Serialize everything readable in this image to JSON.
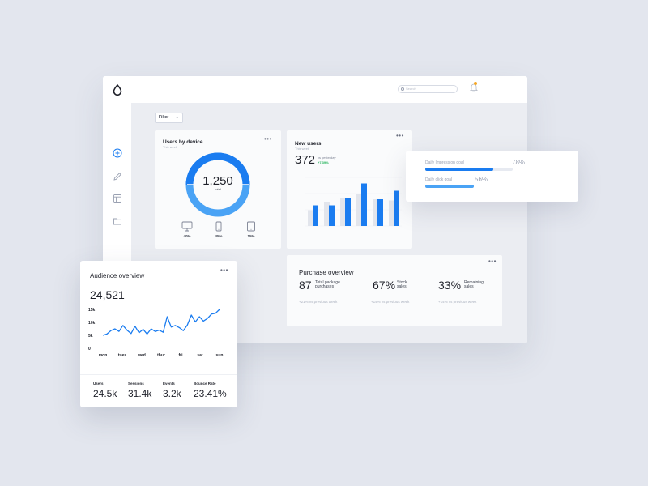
{
  "search": {
    "placeholder": "Search"
  },
  "filter": {
    "label": "Filter",
    "arrow": "→"
  },
  "colors": {
    "accent": "#1a7cf0",
    "accent_light": "#4aa3f5",
    "gray_bar": "#e2e5ec",
    "positive": "#23b35a"
  },
  "sidebar": {
    "icons": [
      "add-circle-icon",
      "pencil-icon",
      "layout-icon",
      "folder-icon"
    ]
  },
  "users_by_device": {
    "title": "Users by device",
    "subtitle": "This week",
    "total": "1,250",
    "total_label": "total",
    "devices": [
      {
        "icon": "desktop-icon",
        "pct": "40%"
      },
      {
        "icon": "mobile-icon",
        "pct": "45%"
      },
      {
        "icon": "tablet-icon",
        "pct": "15%"
      }
    ],
    "donut_share": [
      0.45,
      0.55
    ]
  },
  "new_users": {
    "title": "New users",
    "subtitle": "This week",
    "value": "372",
    "vs_label": "vs yesterday",
    "change": "+7.39%"
  },
  "purchase_overview": {
    "title": "Purchase overview",
    "items": [
      {
        "value": "87",
        "label": "Total package purchases",
        "sub": "+21% vs previous week"
      },
      {
        "value": "67%",
        "label": "Stock sales",
        "sub": "+14% vs previous week"
      },
      {
        "value": "33%",
        "label": "Remaining sales",
        "sub": "+14% vs previous week"
      }
    ]
  },
  "goals": [
    {
      "label": "Daily Impression goal",
      "pct": "78%",
      "value": 0.78,
      "color": "#1a7cf0"
    },
    {
      "label": "Daily click goal",
      "pct": "56%",
      "value": 0.56,
      "color": "#4aa3f5"
    }
  ],
  "audience": {
    "title": "Audience overview",
    "value": "24,521",
    "stats": [
      {
        "label": "Users",
        "value": "24.5k"
      },
      {
        "label": "Sessions",
        "value": "31.4k"
      },
      {
        "label": "Events",
        "value": "3.2k"
      },
      {
        "label": "Bounce Rate",
        "value": "23.41%"
      }
    ]
  },
  "chart_data": [
    {
      "type": "bar",
      "title": "New users",
      "categories": [
        "",
        "",
        "",
        "",
        "",
        ""
      ],
      "yticks": [
        "",
        "",
        "",
        ""
      ],
      "ylim": [
        0,
        4
      ],
      "series": [
        {
          "values": [
            1.3,
            2.0,
            2.3,
            2.6,
            2.2,
            2.1
          ]
        },
        {
          "values": [
            1.7,
            1.7,
            2.3,
            3.5,
            2.2,
            2.9
          ]
        }
      ]
    },
    {
      "type": "line",
      "title": "Audience overview",
      "categories": [
        "mon",
        "tues",
        "wed",
        "thur",
        "fri",
        "sat",
        "sun"
      ],
      "yticks": [
        "15k",
        "10k",
        "5k",
        "0"
      ],
      "ylim": [
        0,
        15
      ],
      "values": [
        5,
        5.5,
        6.8,
        7.5,
        6.5,
        8.8,
        7,
        5.7,
        8.5,
        6,
        7.3,
        5.5,
        7.5,
        6.5,
        7,
        6.2,
        12.2,
        8.2,
        8.8,
        8,
        6.8,
        9,
        12.8,
        10.2,
        12.2,
        10.5,
        11.5,
        13.2,
        13.5,
        15
      ]
    }
  ]
}
